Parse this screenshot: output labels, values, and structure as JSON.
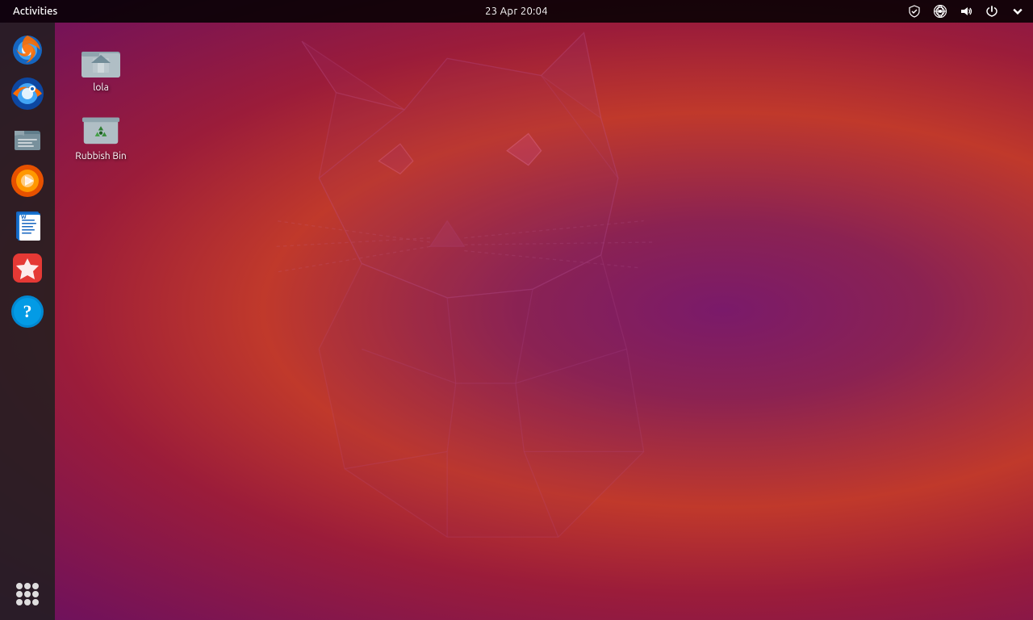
{
  "topbar": {
    "activities_label": "Activities",
    "datetime": "23 Apr  20:04"
  },
  "desktop_icons": [
    {
      "id": "home-folder",
      "label": "lola",
      "icon_type": "home"
    },
    {
      "id": "rubbish-bin",
      "label": "Rubbish Bin",
      "icon_type": "trash"
    }
  ],
  "dock": {
    "apps": [
      {
        "id": "firefox",
        "label": "Firefox Web Browser",
        "icon_type": "firefox"
      },
      {
        "id": "thunderbird",
        "label": "Thunderbird Mail",
        "icon_type": "thunderbird"
      },
      {
        "id": "files",
        "label": "Files",
        "icon_type": "files"
      },
      {
        "id": "rhythmbox",
        "label": "Rhythmbox",
        "icon_type": "rhythmbox"
      },
      {
        "id": "writer",
        "label": "LibreOffice Writer",
        "icon_type": "writer"
      },
      {
        "id": "app-center",
        "label": "App Center",
        "icon_type": "appcenter"
      },
      {
        "id": "help",
        "label": "Help",
        "icon_type": "help"
      }
    ],
    "app_grid_label": "Show Applications"
  },
  "icons": {
    "shield": "🛡",
    "network": "🔗",
    "volume": "🔊",
    "power": "⏻",
    "chevron_down": "▾"
  }
}
